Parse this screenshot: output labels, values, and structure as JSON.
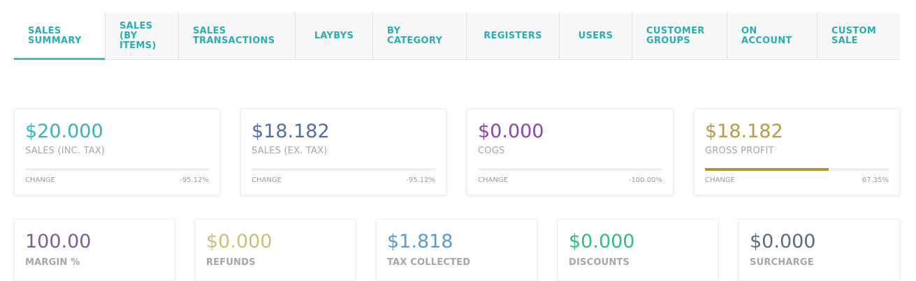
{
  "tabs": [
    {
      "label": "SALES\nSUMMARY",
      "active": true
    },
    {
      "label": "SALES (BY\nITEMS)",
      "active": false
    },
    {
      "label": "SALES\nTRANSACTIONS",
      "active": false
    },
    {
      "label": "LAYBYS",
      "active": false
    },
    {
      "label": "BY CATEGORY",
      "active": false
    },
    {
      "label": "REGISTERS",
      "active": false
    },
    {
      "label": "USERS",
      "active": false
    },
    {
      "label": "CUSTOMER\nGROUPS",
      "active": false
    },
    {
      "label": "ON\nACCOUNT",
      "active": false
    },
    {
      "label": "CUSTOM\nSALE",
      "active": false
    }
  ],
  "colors": {
    "teal": "#3bb3b8",
    "steel_blue": "#4f6fa8",
    "purple": "#8e44ad",
    "gold": "#b99a45",
    "gold_bar": "#b39232",
    "margin_purple": "#7b5f96",
    "refunds_khaki": "#c9c07c",
    "tax_blue": "#5b9bd0",
    "discount_green": "#2ebf7c",
    "surcharge_slate": "#5b6b7f"
  },
  "summary_cards": [
    {
      "value": "$20.000",
      "label": "SALES (INC. TAX)",
      "change_label": "CHANGE",
      "change_value": "-95.12%",
      "bar_fraction": 0,
      "color": "#3bb3b8"
    },
    {
      "value": "$18.182",
      "label": "SALES (EX. TAX)",
      "change_label": "CHANGE",
      "change_value": "-95.12%",
      "bar_fraction": 0,
      "color": "#4f6fa8"
    },
    {
      "value": "$0.000",
      "label": "COGS",
      "change_label": "CHANGE",
      "change_value": "-100.00%",
      "bar_fraction": 0,
      "color": "#8e44ad"
    },
    {
      "value": "$18.182",
      "label": "GROSS PROFIT",
      "change_label": "CHANGE",
      "change_value": "67.35%",
      "bar_fraction": 0.6735,
      "color": "#b99a45",
      "bar_color": "#b39232"
    }
  ],
  "metric_cards": [
    {
      "value": "100.00",
      "label": "MARGIN %",
      "color": "#7b5f96"
    },
    {
      "value": "$0.000",
      "label": "REFUNDS",
      "color": "#c9c07c"
    },
    {
      "value": "$1.818",
      "label": "TAX COLLECTED",
      "color": "#5b9bd0"
    },
    {
      "value": "$0.000",
      "label": "DISCOUNTS",
      "color": "#2ebf7c"
    },
    {
      "value": "$0.000",
      "label": "SURCHARGE",
      "color": "#5b6b7f"
    }
  ]
}
